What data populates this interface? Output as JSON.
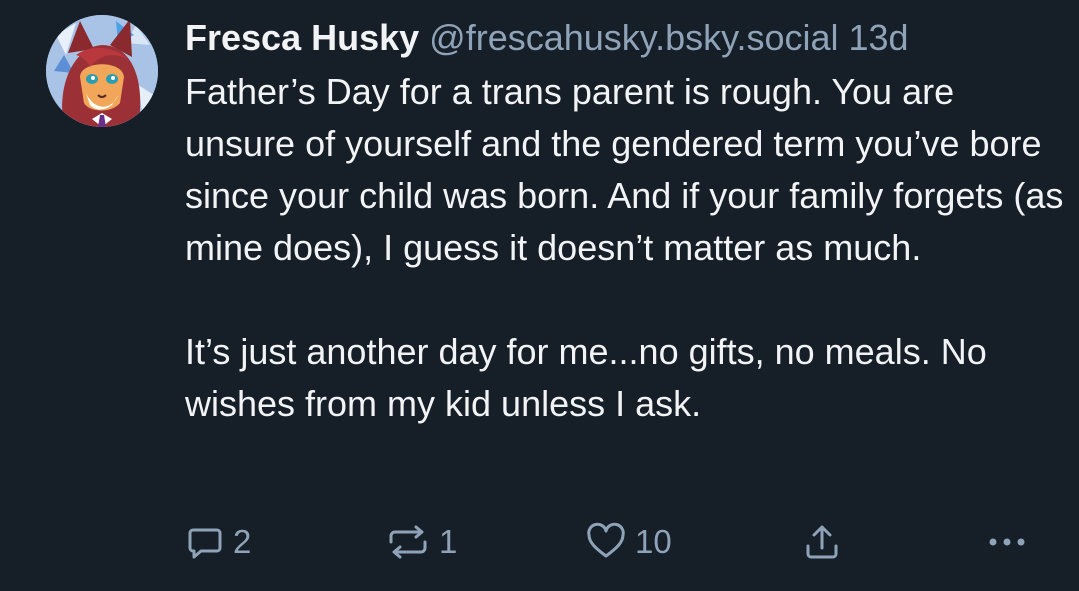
{
  "post": {
    "display_name": "Fresca Husky",
    "handle": "@frescahusky.bsky.social",
    "timestamp": "13d",
    "paragraphs": [
      "Father’s Day for a trans parent is rough. You are unsure of yourself and the gendered term you’ve bore since your child was born. And if your family forgets (as mine does), I guess it doesn’t matter as much.",
      "It’s just another day for me...no gifts, no meals. No wishes from my kid unless I ask."
    ]
  },
  "actions": {
    "reply_count": "2",
    "repost_count": "1",
    "like_count": "10",
    "reply_icon": "speech-bubble-icon",
    "repost_icon": "repost-arrows-icon",
    "like_icon": "heart-icon",
    "share_icon": "share-upload-icon",
    "more_icon": "ellipsis-icon"
  },
  "colors": {
    "background": "#161e27",
    "text": "#f1f3f5",
    "muted": "#8fa3b8"
  }
}
